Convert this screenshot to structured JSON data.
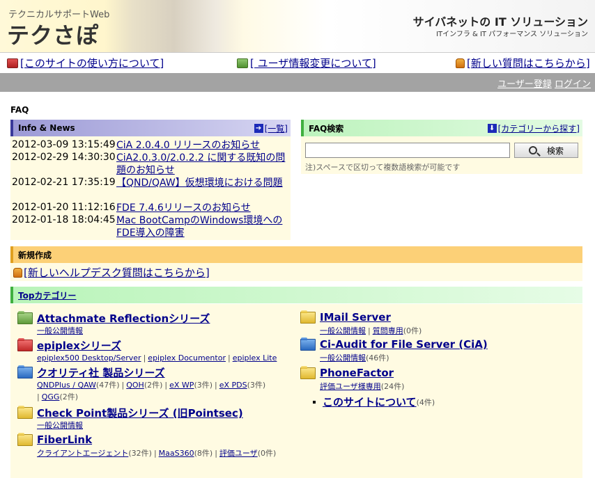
{
  "header": {
    "site_sub": "テクニカルサポートWeb",
    "site_title": "テクさぽ",
    "company": "サイバネットの IT ソリューション",
    "company_sub": "ITインフラ & IT パフォーマンス ソリューション"
  },
  "topnav": {
    "items": [
      {
        "label": "[このサイトの使い方について]",
        "icon": "book-red-icon"
      },
      {
        "label": "[ ユーザ情報変更について]",
        "icon": "book-green-icon"
      },
      {
        "label": "[新しい質問はこちらから]",
        "icon": "hand-icon"
      }
    ]
  },
  "account": {
    "register": "ユーザー登録",
    "login": "ログイン"
  },
  "page_label": "FAQ",
  "info": {
    "title": "Info & News",
    "more": "[一覧]",
    "news": [
      {
        "date": "2012-03-09 13:15:49",
        "title": "CiA 2.0.4.0 リリースのお知らせ"
      },
      {
        "date": "2012-02-29 14:30:30",
        "title": "CiA2.0.3.0/2.0.2.2 に関する既知の問題のお知らせ"
      },
      {
        "date": "2012-02-21 17:35:19",
        "title": "【QND/QAW】仮想環境における問題"
      },
      {
        "date": "2012-01-20 11:12:16",
        "title": "FDE 7.4.6リリースのお知らせ"
      },
      {
        "date": "2012-01-18 18:04:45",
        "title": "Mac BootCampのWindows環境へのFDE導入の障害"
      }
    ]
  },
  "faq_search": {
    "title": "FAQ検索",
    "category_link": "[カテゴリーから探す]",
    "input_value": "",
    "button": "検索",
    "note": "注)スペースで区切って複数語検索が可能です"
  },
  "new_section": {
    "title": "新規作成",
    "link": "[新しいヘルプデスク質問はこちらから]"
  },
  "top_categories": {
    "title": "Topカテゴリー",
    "left": [
      {
        "name": "Attachmate Reflectionシリーズ",
        "folder": "green",
        "subs": [
          {
            "label": "一般公開情報",
            "count": ""
          }
        ]
      },
      {
        "name": "epiplexシリーズ",
        "folder": "red",
        "subs": [
          {
            "label": "epiplex500 Desktop/Server",
            "count": ""
          },
          {
            "label": "epiplex Documentor",
            "count": ""
          },
          {
            "label": "epiplex Lite",
            "count": ""
          }
        ]
      },
      {
        "name": "クオリティ社 製品シリーズ",
        "folder": "blue",
        "subs": [
          {
            "label": "QNDPlus / QAW",
            "count": "(47件)"
          },
          {
            "label": "QOH",
            "count": "(2件)"
          },
          {
            "label": "eX WP",
            "count": "(3件)"
          },
          {
            "label": "eX PDS",
            "count": "(3件)"
          },
          {
            "label": "QGG",
            "count": "(2件)"
          }
        ]
      },
      {
        "name": "Check Point製品シリーズ (旧Pointsec)",
        "folder": "yellow",
        "subs": [
          {
            "label": "一般公開情報",
            "count": ""
          }
        ]
      },
      {
        "name": "FiberLink",
        "folder": "yellow",
        "subs": [
          {
            "label": "クライアントエージェント",
            "count": "(32件)"
          },
          {
            "label": "MaaS360",
            "count": "(8件)"
          },
          {
            "label": "評価ユーザ",
            "count": "(0件)"
          }
        ]
      }
    ],
    "right": [
      {
        "name": "IMail Server",
        "folder": "yellow",
        "subs": [
          {
            "label": "一般公開情報",
            "count": ""
          },
          {
            "label": "質問専用",
            "count": "(0件)"
          }
        ]
      },
      {
        "name": "Ci-Audit for File Server (CiA)",
        "folder": "blue",
        "subs": [
          {
            "label": "一般公開情報",
            "count": "(46件)"
          }
        ]
      },
      {
        "name": "PhoneFactor",
        "folder": "yellow",
        "subs": [
          {
            "label": "評価ユーザ様専用",
            "count": "(24件)"
          }
        ]
      }
    ],
    "about": {
      "label": "このサイトについて",
      "count": "(4件)"
    }
  }
}
